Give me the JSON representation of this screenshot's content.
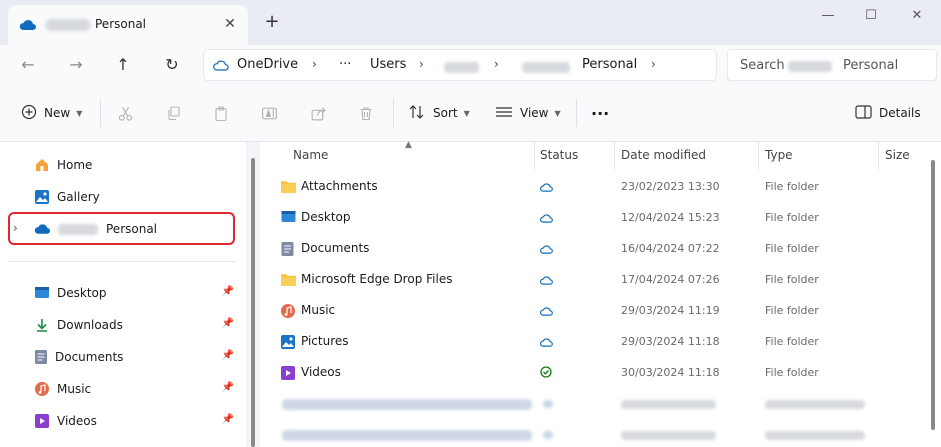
{
  "tab": {
    "title": "Personal",
    "close": "✕",
    "new_tab": "+"
  },
  "window": {
    "minimize": "—",
    "maximize": "☐",
    "close": "✕"
  },
  "nav": {
    "back": "←",
    "forward": "→",
    "up": "↑",
    "refresh": "↻",
    "breadcrumb": [
      "OneDrive",
      "Users",
      "Personal"
    ],
    "more_crumbs": "···",
    "search_label": "Search",
    "search_scope": "Personal"
  },
  "toolbar": {
    "new_label": "New",
    "sort_label": "Sort",
    "view_label": "View",
    "more": "···",
    "details_label": "Details"
  },
  "sidebar": {
    "top": [
      {
        "label": "Home",
        "icon": "home-icon"
      },
      {
        "label": "Gallery",
        "icon": "gallery-icon"
      }
    ],
    "onedrive": {
      "label": "Personal",
      "icon": "onedrive-cloud-icon",
      "expand": "›"
    },
    "quick": [
      {
        "label": "Desktop",
        "icon": "desktop-icon"
      },
      {
        "label": "Downloads",
        "icon": "download-icon"
      },
      {
        "label": "Documents",
        "icon": "documents-icon"
      },
      {
        "label": "Music",
        "icon": "music-icon"
      },
      {
        "label": "Videos",
        "icon": "videos-icon"
      }
    ]
  },
  "columns": {
    "name": "Name",
    "status": "Status",
    "date": "Date modified",
    "type": "Type",
    "size": "Size"
  },
  "files": [
    {
      "name": "Attachments",
      "icon": "folder-icon",
      "status": "cloud",
      "date": "23/02/2023 13:30",
      "type": "File folder"
    },
    {
      "name": "Desktop",
      "icon": "desktop-icon",
      "status": "cloud",
      "date": "12/04/2024 15:23",
      "type": "File folder"
    },
    {
      "name": "Documents",
      "icon": "documents-icon",
      "status": "cloud",
      "date": "16/04/2024 07:22",
      "type": "File folder"
    },
    {
      "name": "Microsoft Edge Drop Files",
      "icon": "folder-icon",
      "status": "cloud",
      "date": "17/04/2024 07:26",
      "type": "File folder"
    },
    {
      "name": "Music",
      "icon": "music-icon",
      "status": "cloud",
      "date": "29/03/2024 11:19",
      "type": "File folder"
    },
    {
      "name": "Pictures",
      "icon": "pictures-icon",
      "status": "cloud",
      "date": "29/03/2024 11:18",
      "type": "File folder"
    },
    {
      "name": "Videos",
      "icon": "videos-icon",
      "status": "synced",
      "date": "30/03/2024 11:18",
      "type": "File folder"
    }
  ],
  "colors": {
    "cloud": "#0f6cbd",
    "synced": "#107c10",
    "folder": "#f5c242",
    "highlight": "#e0292e"
  }
}
